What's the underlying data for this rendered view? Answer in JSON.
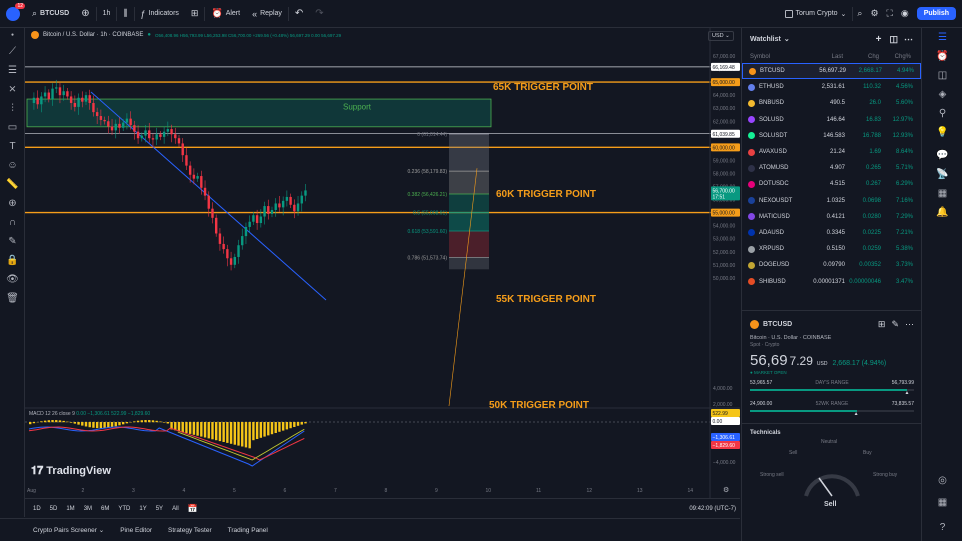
{
  "topbar": {
    "avatar_badge": "12",
    "symbol": "BTCUSD",
    "interval": "1h",
    "indicators": "Indicators",
    "alert": "Alert",
    "replay": "Replay",
    "layout_name": "Torum Crypto",
    "publish": "Publish"
  },
  "chart": {
    "title": "Bitcoin / U.S. Dollar · 1h · COINBASE",
    "ohlc": "O56,408.96 H56,793.99 L56,253.98 C56,700.00 +269.56 (+0.48%) 56,697.29 0.00 56,697.29",
    "currency": "USD",
    "accent_color": "#089981",
    "down_color": "#f23645",
    "price_axis": [
      "67,000.00",
      "66,000.00",
      "65,000.00",
      "64,000.00",
      "63,000.00",
      "62,000.00",
      "61,000.00",
      "60,000.00",
      "59,000.00",
      "58,000.00",
      "57,000.00",
      "56,000.00",
      "55,000.00",
      "54,000.00",
      "53,000.00",
      "52,000.00",
      "51,000.00",
      "50,000.00"
    ],
    "price_tags": {
      "high_line": "66,169.48",
      "tp65": "65,000.00",
      "fib0": "61,039.85",
      "tp60": "60,000.00",
      "current": "56,700.00",
      "current_countdown": "17:51",
      "tp55": "55,000.00"
    },
    "date_axis": [
      "Aug",
      "2",
      "3",
      "4",
      "5",
      "6",
      "7",
      "8",
      "9",
      "10",
      "11",
      "12",
      "13",
      "14"
    ],
    "labels": {
      "tp65": "65K TRIGGER POINT",
      "tp60": "60K TRIGGER POINT",
      "tp55": "55K TRIGGER POINT",
      "tp50": "50K TRIGGER POINT",
      "support": "Support"
    },
    "fib": [
      {
        "label": "0 (61,014.44)"
      },
      {
        "label": "0.236 (58,179.83)"
      },
      {
        "label": "0.382 (56,426.21)"
      },
      {
        "label": "0.5 (55,008.91)"
      },
      {
        "label": "0.618 (53,591.60)"
      },
      {
        "label": "0.786 (51,573.74)"
      }
    ],
    "macd": {
      "title": "MACD 12 26 close 9",
      "values": "0.00  −1,306.61  522.99  −1,829.60",
      "axis": [
        "4,000.00",
        "2,000.00",
        "0.00",
        "−2,000.00",
        "−4,000.00"
      ],
      "tags": [
        "522.99",
        "0.00",
        "−1,306.61",
        "−1,829.60"
      ]
    },
    "watermark": "TradingView"
  },
  "bottombar": {
    "ranges": [
      "1D",
      "5D",
      "1M",
      "3M",
      "6M",
      "YTD",
      "1Y",
      "5Y",
      "All"
    ],
    "clock": "09:42:09 (UTC-7)"
  },
  "panels": [
    "Crypto Pairs Screener",
    "Pine Editor",
    "Strategy Tester",
    "Trading Panel"
  ],
  "watchlist": {
    "title": "Watchlist",
    "columns": [
      "Symbol",
      "Last",
      "Chg",
      "Chg%"
    ],
    "rows": [
      {
        "sym": "BTCUSD",
        "last": "56,697.29",
        "chg": "2,668.17",
        "chgp": "4.94%",
        "color": "#f7931a"
      },
      {
        "sym": "ETHUSD",
        "last": "2,531.61",
        "chg": "110.32",
        "chgp": "4.56%",
        "color": "#627eea"
      },
      {
        "sym": "BNBUSD",
        "last": "490.5",
        "chg": "26.0",
        "chgp": "5.60%",
        "color": "#f3ba2f"
      },
      {
        "sym": "SOLUSD",
        "last": "146.64",
        "chg": "16.83",
        "chgp": "12.97%",
        "color": "#9945ff"
      },
      {
        "sym": "SOLUSDT",
        "last": "146.583",
        "chg": "16.788",
        "chgp": "12.93%",
        "color": "#14f195"
      },
      {
        "sym": "AVAXUSD",
        "last": "21.24",
        "chg": "1.69",
        "chgp": "8.64%",
        "color": "#e84142"
      },
      {
        "sym": "ATOMUSD",
        "last": "4.907",
        "chg": "0.265",
        "chgp": "5.71%",
        "color": "#2e3148"
      },
      {
        "sym": "DOTUSDC",
        "last": "4.515",
        "chg": "0.267",
        "chgp": "6.29%",
        "color": "#e6007a"
      },
      {
        "sym": "NEXOUSDT",
        "last": "1.0325",
        "chg": "0.0698",
        "chgp": "7.16%",
        "color": "#1a4199"
      },
      {
        "sym": "MATICUSD",
        "last": "0.4121",
        "chg": "0.0280",
        "chgp": "7.29%",
        "color": "#8247e5"
      },
      {
        "sym": "ADAUSD",
        "last": "0.3345",
        "chg": "0.0225",
        "chgp": "7.21%",
        "color": "#0033ad"
      },
      {
        "sym": "XRPUSD",
        "last": "0.5150",
        "chg": "0.0259",
        "chgp": "5.38%",
        "color": "#9aa0a6"
      },
      {
        "sym": "DOGEUSD",
        "last": "0.09790",
        "chg": "0.00352",
        "chgp": "3.73%",
        "color": "#c2a633"
      },
      {
        "sym": "SHIBUSD",
        "last": "0.00001371",
        "chg": "0.00000046",
        "chgp": "3.47%",
        "color": "#e44c25"
      }
    ]
  },
  "details": {
    "symbol": "BTCUSD",
    "desc": "Bitcoin · U.S. Dollar · COINBASE",
    "sub": "Spot · Crypto",
    "price_main": "56,69",
    "price_frac": "7.29",
    "currency": "USD",
    "change": "2,668.17 (4.94%)",
    "status": "● MARKET OPEN",
    "days_low": "53,965.57",
    "days_label": "DAY'S RANGE",
    "days_high": "56,793.99",
    "days_pos": 0.96,
    "wk_low": "24,900.00",
    "wk_label": "52WK RANGE",
    "wk_high": "73,835.57",
    "wk_pos": 0.65,
    "technicals": "Technicals",
    "gauge_labels": [
      "Neutral",
      "Sell",
      "Buy",
      "Strong sell",
      "Strong buy"
    ],
    "gauge_result": "Sell"
  }
}
